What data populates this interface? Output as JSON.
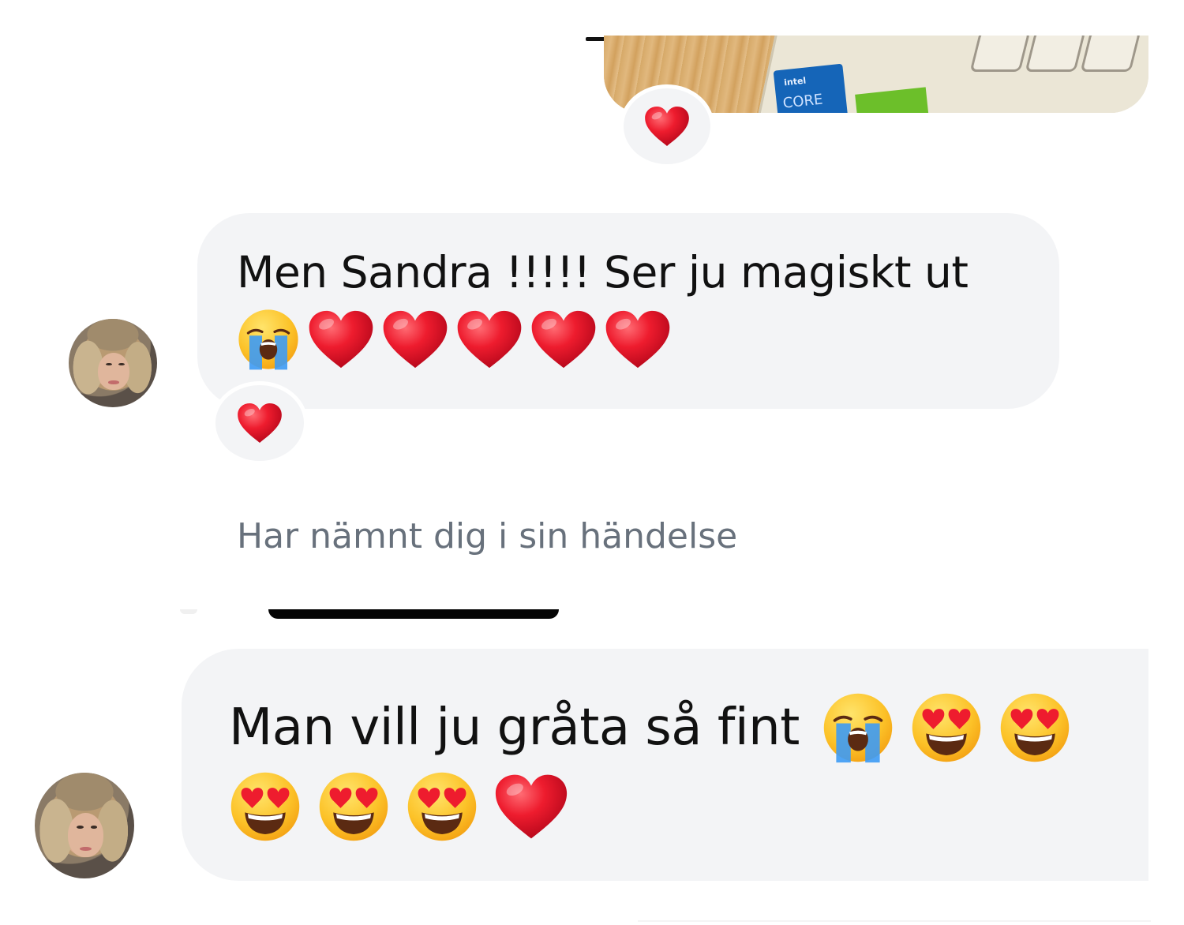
{
  "chat": {
    "message_1": {
      "text": "Men Sandra !!!!! Ser ju magiskt ut",
      "emojis": [
        "crying-face",
        "heart",
        "heart",
        "heart",
        "heart",
        "heart"
      ],
      "reaction": "heart"
    },
    "top_photo_reaction": "heart",
    "mention_notice": "Har nämnt dig i sin händelse",
    "message_2": {
      "text": "Man vill ju gråta så fint",
      "emojis_line_1": [
        "crying-face",
        "heart-eyes-face",
        "heart-eyes-face"
      ],
      "emojis_line_2": [
        "heart-eyes-face",
        "heart-eyes-face",
        "heart-eyes-face",
        "heart"
      ]
    }
  },
  "colors": {
    "bubble_bg": "#f3f4f6",
    "text": "#111111",
    "muted_text": "#68717c",
    "heart_red": "#e8182c"
  }
}
